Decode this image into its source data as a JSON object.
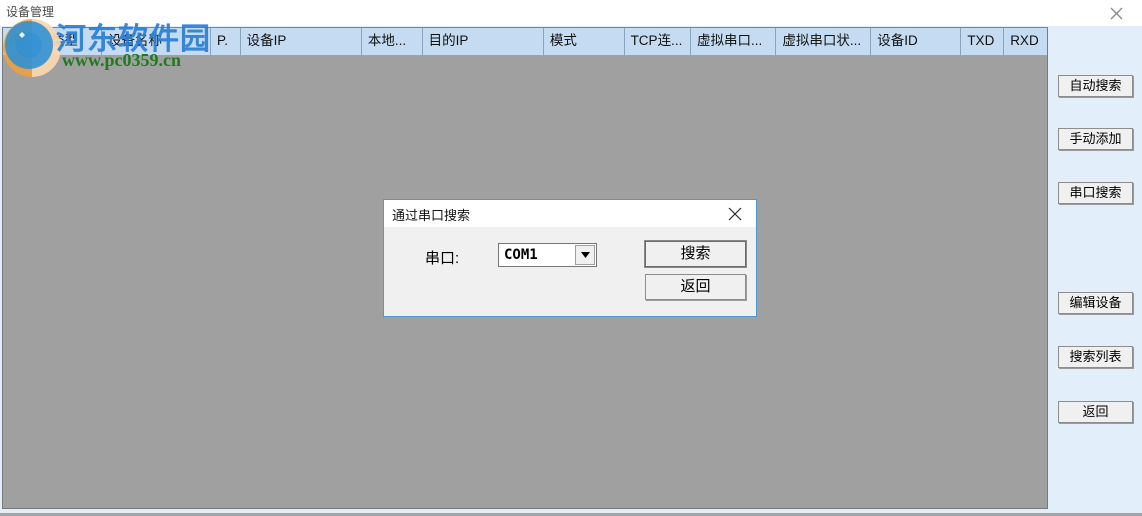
{
  "window": {
    "title": "设备管理",
    "close_icon": "close-icon"
  },
  "device_list": {
    "columns": [
      {
        "label": "序",
        "width": 44
      },
      {
        "label": "类型",
        "width": 60
      },
      {
        "label": "设备名称",
        "width": 115
      },
      {
        "label": "P.",
        "width": 31
      },
      {
        "label": "设备IP",
        "width": 128
      },
      {
        "label": "本地...",
        "width": 64
      },
      {
        "label": "目的IP",
        "width": 128
      },
      {
        "label": "模式",
        "width": 85
      },
      {
        "label": "TCP连...",
        "width": 70
      },
      {
        "label": "虚拟串口...",
        "width": 90
      },
      {
        "label": "虚拟串口状...",
        "width": 100
      },
      {
        "label": "设备ID",
        "width": 95
      },
      {
        "label": "TXD",
        "width": 45
      },
      {
        "label": "RXD",
        "width": 45
      }
    ],
    "rows": []
  },
  "side_panel": {
    "buttons": [
      {
        "label": "自动搜索",
        "name": "auto-search"
      },
      {
        "label": "手动添加",
        "name": "manual-add"
      },
      {
        "label": "串口搜索",
        "name": "serial-search"
      },
      {
        "label": "编辑设备",
        "name": "edit-device"
      },
      {
        "label": "搜索列表",
        "name": "search-list"
      },
      {
        "label": "返回",
        "name": "back"
      }
    ]
  },
  "dialog": {
    "title": "通过串口搜索",
    "close_icon": "close-icon",
    "serial_port_label": "串口:",
    "serial_port_value": "COM1",
    "serial_port_options": [
      "COM1"
    ],
    "dropdown_icon": "chevron-down-icon",
    "search_button": "搜索",
    "back_button": "返回"
  },
  "watermark": {
    "site_name": "河东软件园",
    "url": "www.pc0359.cn"
  },
  "colors": {
    "header_blue": "#c5dbf2",
    "panel_blue": "#e3eefb",
    "list_gray": "#a0a0a0",
    "dialog_border": "#4c97d6",
    "watermark_blue": "#2b7fd4",
    "watermark_green": "#1f7a1f"
  }
}
